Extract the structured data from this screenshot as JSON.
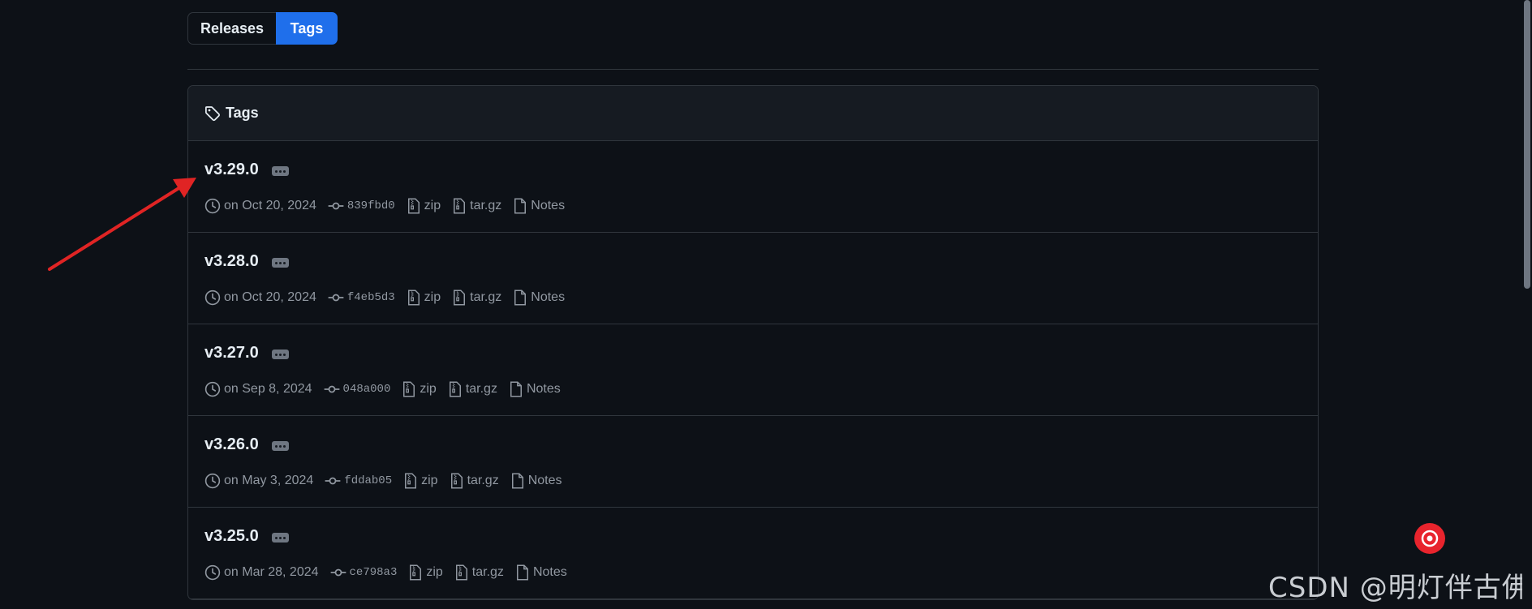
{
  "toggle": {
    "releases_label": "Releases",
    "tags_label": "Tags"
  },
  "box": {
    "header_title": "Tags"
  },
  "tags": [
    {
      "name": "v3.29.0",
      "date": "on Oct 20, 2024",
      "sha": "839fbd0",
      "zip": "zip",
      "targz": "tar.gz",
      "notes": "Notes"
    },
    {
      "name": "v3.28.0",
      "date": "on Oct 20, 2024",
      "sha": "f4eb5d3",
      "zip": "zip",
      "targz": "tar.gz",
      "notes": "Notes"
    },
    {
      "name": "v3.27.0",
      "date": "on Sep 8, 2024",
      "sha": "048a000",
      "zip": "zip",
      "targz": "tar.gz",
      "notes": "Notes"
    },
    {
      "name": "v3.26.0",
      "date": "on May 3, 2024",
      "sha": "fddab05",
      "zip": "zip",
      "targz": "tar.gz",
      "notes": "Notes"
    },
    {
      "name": "v3.25.0",
      "date": "on Mar 28, 2024",
      "sha": "ce798a3",
      "zip": "zip",
      "targz": "tar.gz",
      "notes": "Notes"
    }
  ],
  "watermark": "CSDN @明灯伴古佛",
  "colors": {
    "accent": "#1f6feb",
    "background": "#0d1117",
    "arrow": "#e02424",
    "badge": "#e8242d"
  },
  "icons": {
    "header": "tag-icon",
    "date": "clock-icon",
    "sha": "git-commit-icon",
    "zip": "file-zip-icon",
    "targz": "file-zip-icon",
    "notes": "file-icon",
    "more": "kebab-horizontal-icon"
  }
}
